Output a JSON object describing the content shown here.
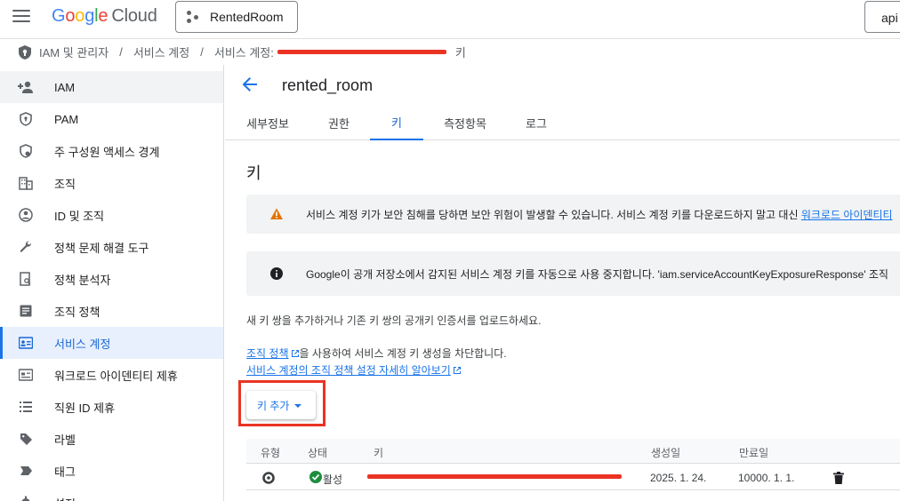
{
  "topbar": {
    "logo_google": [
      "G",
      "o",
      "o",
      "g",
      "l",
      "e"
    ],
    "logo_cloud": "Cloud",
    "project": "RentedRoom",
    "api_label": "api"
  },
  "breadcrumb": {
    "iam": "IAM 및 관리자",
    "service_accounts": "서비스 계정",
    "current_prefix": "서비스 계정:",
    "current_suffix": "키",
    "sep": "/"
  },
  "sidebar": {
    "items": [
      {
        "label": "IAM",
        "icon": "person-add-icon"
      },
      {
        "label": "PAM",
        "icon": "shield-lock-icon"
      },
      {
        "label": "주 구성원 액세스 경계",
        "icon": "boundary-icon"
      },
      {
        "label": "조직",
        "icon": "building-icon"
      },
      {
        "label": "ID 및 조직",
        "icon": "account-circle-icon"
      },
      {
        "label": "정책 문제 해결 도구",
        "icon": "wrench-icon"
      },
      {
        "label": "정책 분석자",
        "icon": "policy-search-icon"
      },
      {
        "label": "조직 정책",
        "icon": "list-document-icon"
      },
      {
        "label": "서비스 계정",
        "icon": "service-account-icon"
      },
      {
        "label": "워크로드 아이덴티티 제휴",
        "icon": "id-card-icon"
      },
      {
        "label": "직원 ID 제휴",
        "icon": "list-icon"
      },
      {
        "label": "라벨",
        "icon": "label-icon"
      },
      {
        "label": "태그",
        "icon": "tag-arrow-icon"
      },
      {
        "label": "설정",
        "icon": "settings-icon"
      }
    ]
  },
  "main": {
    "title": "rented_room",
    "tabs": [
      "세부정보",
      "권한",
      "키",
      "측정항목",
      "로그"
    ],
    "active_tab": "키",
    "section_title": "키",
    "warning": {
      "text": "서비스 계정 키가 보안 침해를 당하면 보안 위험이 발생할 수 있습니다. 서비스 계정 키를 다운로드하지 말고 대신 ",
      "link": "워크로드 아이덴티티"
    },
    "info": {
      "text": "Google이 공개 저장소에서 감지된 서비스 계정 키를 자동으로 사용 중지합니다. 'iam.serviceAccountKeyExposureResponse' 조직"
    },
    "upload_desc": "새 키 쌍을 추가하거나 기존 키 쌍의 공개키 인증서를 업로드하세요.",
    "org_policy_link": "조직 정책",
    "org_policy_text": "을 사용하여 서비스 계정 키 생성을 차단합니다.",
    "learn_more_link": "서비스 계정의 조직 정책 설정 자세히 알아보기",
    "add_key_label": "키 추가",
    "table": {
      "headers": [
        "유형",
        "상태",
        "키",
        "생성일",
        "만료일"
      ],
      "rows": [
        {
          "type_icon": "key-gear-icon",
          "status": "활성",
          "key": "",
          "created": "2025. 1. 24.",
          "expires": "10000. 1. 1."
        }
      ]
    }
  },
  "colors": {
    "accent": "#1a73e8",
    "redaction": "#ea3323",
    "warning": "#e37400",
    "success": "#1e8e3e"
  }
}
